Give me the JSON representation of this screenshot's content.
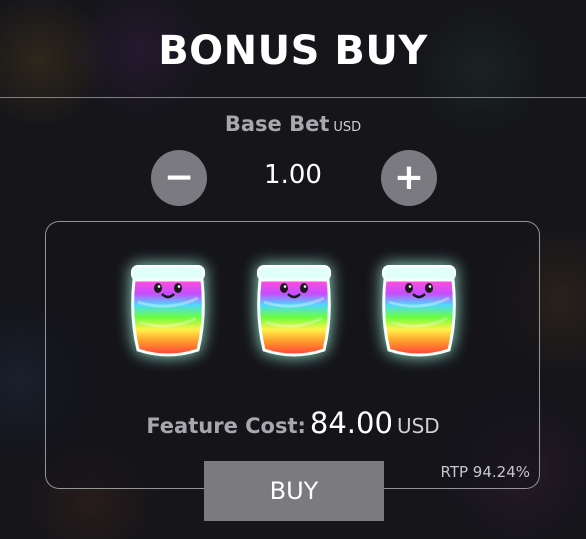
{
  "title": "BONUS BUY",
  "base_bet": {
    "label": "Base Bet",
    "currency": "USD",
    "value": "1.00",
    "minus": "−",
    "plus": "+"
  },
  "feature": {
    "label": "Feature Cost:",
    "value": "84.00",
    "currency": "USD"
  },
  "buy_label": "BUY",
  "rtp": "RTP 94.24%",
  "symbol_icon": "rainbow-jar-icon",
  "symbol_count": 3
}
